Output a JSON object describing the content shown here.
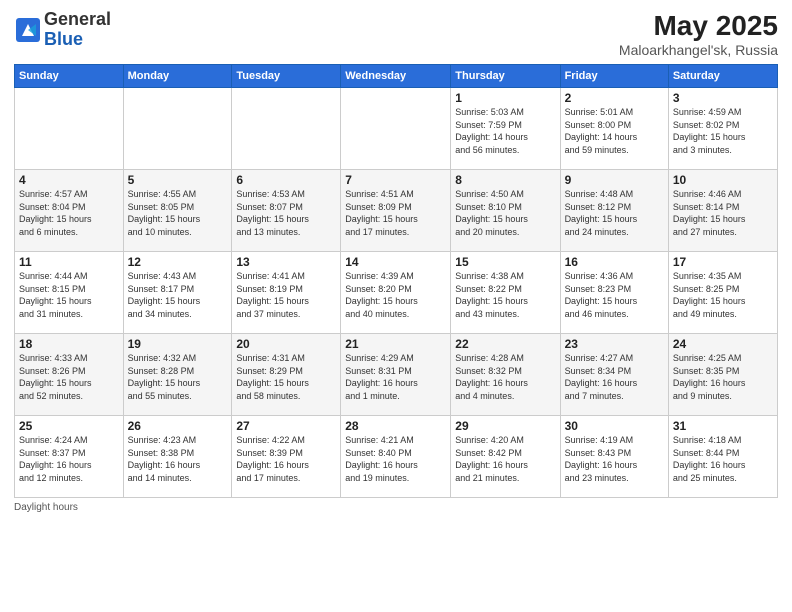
{
  "header": {
    "logo_line1": "General",
    "logo_line2": "Blue",
    "title": "May 2025",
    "location": "Maloarkhangel'sk, Russia"
  },
  "weekdays": [
    "Sunday",
    "Monday",
    "Tuesday",
    "Wednesday",
    "Thursday",
    "Friday",
    "Saturday"
  ],
  "weeks": [
    [
      {
        "day": "",
        "info": ""
      },
      {
        "day": "",
        "info": ""
      },
      {
        "day": "",
        "info": ""
      },
      {
        "day": "",
        "info": ""
      },
      {
        "day": "1",
        "info": "Sunrise: 5:03 AM\nSunset: 7:59 PM\nDaylight: 14 hours\nand 56 minutes."
      },
      {
        "day": "2",
        "info": "Sunrise: 5:01 AM\nSunset: 8:00 PM\nDaylight: 14 hours\nand 59 minutes."
      },
      {
        "day": "3",
        "info": "Sunrise: 4:59 AM\nSunset: 8:02 PM\nDaylight: 15 hours\nand 3 minutes."
      }
    ],
    [
      {
        "day": "4",
        "info": "Sunrise: 4:57 AM\nSunset: 8:04 PM\nDaylight: 15 hours\nand 6 minutes."
      },
      {
        "day": "5",
        "info": "Sunrise: 4:55 AM\nSunset: 8:05 PM\nDaylight: 15 hours\nand 10 minutes."
      },
      {
        "day": "6",
        "info": "Sunrise: 4:53 AM\nSunset: 8:07 PM\nDaylight: 15 hours\nand 13 minutes."
      },
      {
        "day": "7",
        "info": "Sunrise: 4:51 AM\nSunset: 8:09 PM\nDaylight: 15 hours\nand 17 minutes."
      },
      {
        "day": "8",
        "info": "Sunrise: 4:50 AM\nSunset: 8:10 PM\nDaylight: 15 hours\nand 20 minutes."
      },
      {
        "day": "9",
        "info": "Sunrise: 4:48 AM\nSunset: 8:12 PM\nDaylight: 15 hours\nand 24 minutes."
      },
      {
        "day": "10",
        "info": "Sunrise: 4:46 AM\nSunset: 8:14 PM\nDaylight: 15 hours\nand 27 minutes."
      }
    ],
    [
      {
        "day": "11",
        "info": "Sunrise: 4:44 AM\nSunset: 8:15 PM\nDaylight: 15 hours\nand 31 minutes."
      },
      {
        "day": "12",
        "info": "Sunrise: 4:43 AM\nSunset: 8:17 PM\nDaylight: 15 hours\nand 34 minutes."
      },
      {
        "day": "13",
        "info": "Sunrise: 4:41 AM\nSunset: 8:19 PM\nDaylight: 15 hours\nand 37 minutes."
      },
      {
        "day": "14",
        "info": "Sunrise: 4:39 AM\nSunset: 8:20 PM\nDaylight: 15 hours\nand 40 minutes."
      },
      {
        "day": "15",
        "info": "Sunrise: 4:38 AM\nSunset: 8:22 PM\nDaylight: 15 hours\nand 43 minutes."
      },
      {
        "day": "16",
        "info": "Sunrise: 4:36 AM\nSunset: 8:23 PM\nDaylight: 15 hours\nand 46 minutes."
      },
      {
        "day": "17",
        "info": "Sunrise: 4:35 AM\nSunset: 8:25 PM\nDaylight: 15 hours\nand 49 minutes."
      }
    ],
    [
      {
        "day": "18",
        "info": "Sunrise: 4:33 AM\nSunset: 8:26 PM\nDaylight: 15 hours\nand 52 minutes."
      },
      {
        "day": "19",
        "info": "Sunrise: 4:32 AM\nSunset: 8:28 PM\nDaylight: 15 hours\nand 55 minutes."
      },
      {
        "day": "20",
        "info": "Sunrise: 4:31 AM\nSunset: 8:29 PM\nDaylight: 15 hours\nand 58 minutes."
      },
      {
        "day": "21",
        "info": "Sunrise: 4:29 AM\nSunset: 8:31 PM\nDaylight: 16 hours\nand 1 minute."
      },
      {
        "day": "22",
        "info": "Sunrise: 4:28 AM\nSunset: 8:32 PM\nDaylight: 16 hours\nand 4 minutes."
      },
      {
        "day": "23",
        "info": "Sunrise: 4:27 AM\nSunset: 8:34 PM\nDaylight: 16 hours\nand 7 minutes."
      },
      {
        "day": "24",
        "info": "Sunrise: 4:25 AM\nSunset: 8:35 PM\nDaylight: 16 hours\nand 9 minutes."
      }
    ],
    [
      {
        "day": "25",
        "info": "Sunrise: 4:24 AM\nSunset: 8:37 PM\nDaylight: 16 hours\nand 12 minutes."
      },
      {
        "day": "26",
        "info": "Sunrise: 4:23 AM\nSunset: 8:38 PM\nDaylight: 16 hours\nand 14 minutes."
      },
      {
        "day": "27",
        "info": "Sunrise: 4:22 AM\nSunset: 8:39 PM\nDaylight: 16 hours\nand 17 minutes."
      },
      {
        "day": "28",
        "info": "Sunrise: 4:21 AM\nSunset: 8:40 PM\nDaylight: 16 hours\nand 19 minutes."
      },
      {
        "day": "29",
        "info": "Sunrise: 4:20 AM\nSunset: 8:42 PM\nDaylight: 16 hours\nand 21 minutes."
      },
      {
        "day": "30",
        "info": "Sunrise: 4:19 AM\nSunset: 8:43 PM\nDaylight: 16 hours\nand 23 minutes."
      },
      {
        "day": "31",
        "info": "Sunrise: 4:18 AM\nSunset: 8:44 PM\nDaylight: 16 hours\nand 25 minutes."
      }
    ]
  ],
  "footer": "Daylight hours"
}
